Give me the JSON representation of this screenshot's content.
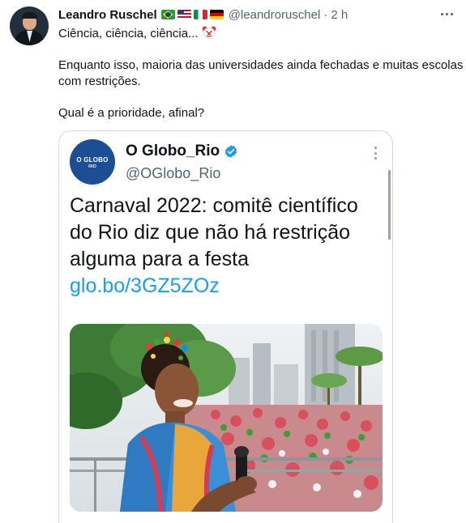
{
  "tweet": {
    "author_name": "Leandro Ruschel",
    "author_handle": "@leandroruschel",
    "separator": "·",
    "time": "2 h",
    "line1": "Ciência, ciência, ciência...",
    "line2": "Enquanto isso, maioria das universidades ainda fechadas e muitas escolas com restrições.",
    "line3": "Qual é a prioridade, afinal?",
    "flags": [
      "flag-brazil-icon",
      "flag-usa-icon",
      "flag-italy-icon",
      "flag-germany-icon"
    ],
    "emoji": "clown-face-icon"
  },
  "embed": {
    "logo_line1": "O GLOBO",
    "logo_line2": "RIO",
    "name": "O Globo_Rio",
    "handle": "@OGlobo_Rio",
    "text": "Carnaval 2022: comitê científico do Rio diz que não há restrição alguma para a festa ",
    "link": "glo.bo/3GZ5ZOz",
    "image": "carnival-photo-woman-with-microphone-and-crowd"
  },
  "colors": {
    "text": "#0f1419",
    "secondary": "#536471",
    "link": "#1d9bf0",
    "border": "#cfd9de",
    "globo_blue": "#1b4e93"
  }
}
